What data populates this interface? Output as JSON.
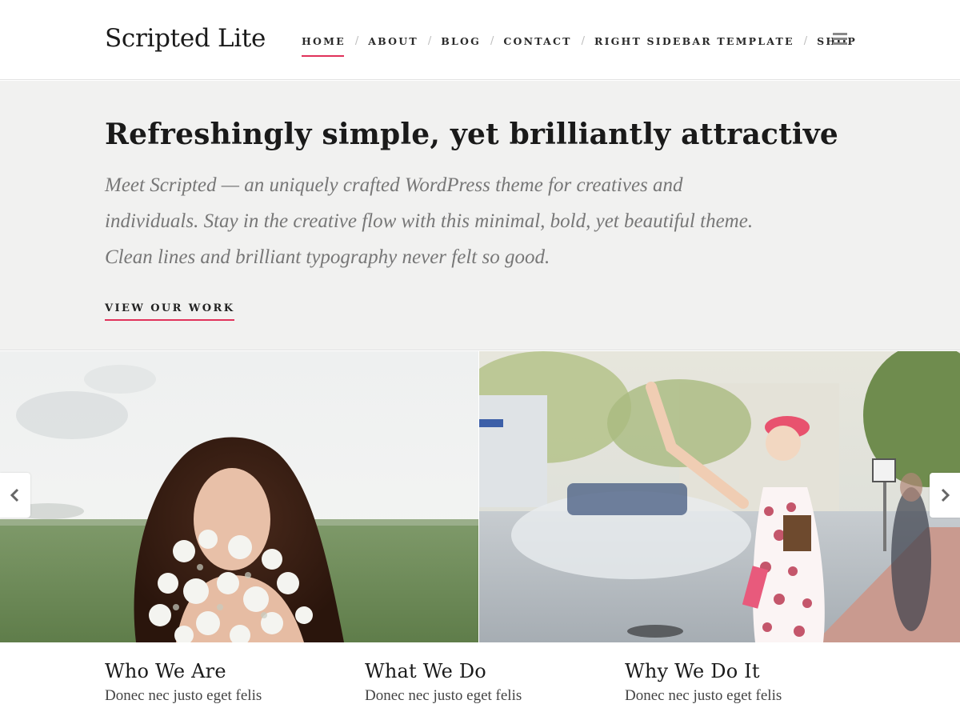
{
  "site": {
    "title": "Scripted Lite"
  },
  "nav": {
    "items": [
      {
        "label": "HOME",
        "active": true
      },
      {
        "label": "ABOUT",
        "active": false
      },
      {
        "label": "BLOG",
        "active": false
      },
      {
        "label": "CONTACT",
        "active": false
      },
      {
        "label": "RIGHT SIDEBAR TEMPLATE",
        "active": false
      },
      {
        "label": "SHOP",
        "active": false
      }
    ],
    "separator": "/",
    "menu_icon": "hamburger-icon"
  },
  "hero": {
    "title": "Refreshingly simple, yet brilliantly attractive",
    "lines": [
      "Meet Scripted — an uniquely crafted WordPress theme for creatives and",
      "individuals. Stay in the creative flow with this minimal, bold, yet beautiful theme.",
      "Clean lines and brilliant typography never felt so good."
    ],
    "cta": "VIEW OUR WORK"
  },
  "slider": {
    "prev_icon": "chevron-left-icon",
    "next_icon": "chevron-right-icon"
  },
  "features": [
    {
      "title": "Who We Are",
      "text": "Donec nec justo eget felis"
    },
    {
      "title": "What We Do",
      "text": "Donec nec justo eget felis"
    },
    {
      "title": "Why We Do It",
      "text": "Donec nec justo eget felis"
    }
  ],
  "colors": {
    "accent": "#e0325a",
    "hero_bg": "#f1f1f0",
    "text": "#222222",
    "muted": "#777777"
  }
}
